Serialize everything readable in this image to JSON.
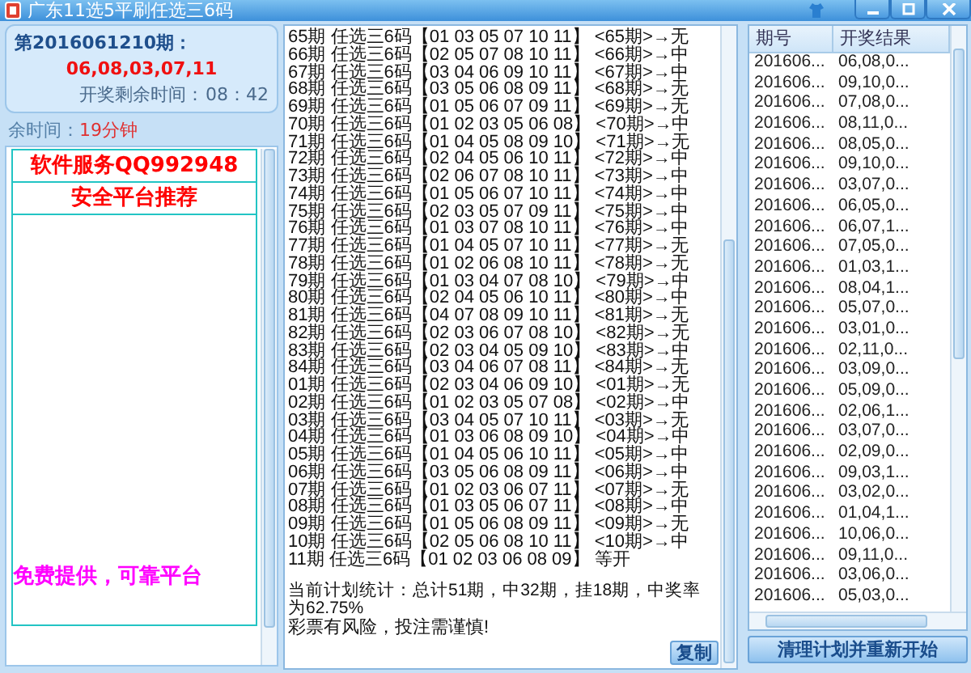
{
  "window": {
    "title": "广东11选5平刷任选三6码"
  },
  "draw_info": {
    "period": "第2016061210期：",
    "numbers": "06,08,03,07,11",
    "countdown_label": "开奖剩余时间：",
    "countdown": "08：42"
  },
  "remaining": {
    "label": "余时间：",
    "value": "19分钟"
  },
  "ads": [
    {
      "text": "软件服务QQ992948",
      "color": "#ff0000"
    },
    {
      "text": "安全平台推荐",
      "color": "#ff0000"
    },
    {
      "text": "免费提供，可靠平台",
      "color": "#ff00ff"
    }
  ],
  "plan": {
    "lines": [
      "65期 任选三6码【01 03 05 07 10 11】 <65期>→无",
      "66期 任选三6码【02 05 07 08 10 11】 <66期>→中",
      "67期 任选三6码【03 04 06 09 10 11】 <67期>→中",
      "68期 任选三6码【03 05 06 08 09 11】 <68期>→无",
      "69期 任选三6码【01 05 06 07 09 11】 <69期>→无",
      "70期 任选三6码【01 02 03 05 06 08】 <70期>→中",
      "71期 任选三6码【01 04 05 08 09 10】 <71期>→无",
      "72期 任选三6码【02 04 05 06 10 11】 <72期>→中",
      "73期 任选三6码【02 06 07 08 10 11】 <73期>→中",
      "74期 任选三6码【01 05 06 07 10 11】 <74期>→中",
      "75期 任选三6码【02 03 05 07 09 11】 <75期>→中",
      "76期 任选三6码【01 03 07 08 10 11】 <76期>→中",
      "77期 任选三6码【01 04 05 07 10 11】 <77期>→无",
      "78期 任选三6码【01 02 06 08 10 11】 <78期>→无",
      "79期 任选三6码【01 03 04 07 08 10】 <79期>→中",
      "80期 任选三6码【02 04 05 06 10 11】 <80期>→中",
      "81期 任选三6码【04 07 08 09 10 11】 <81期>→无",
      "82期 任选三6码【02 03 06 07 08 10】 <82期>→无",
      "83期 任选三6码【02 03 04 05 09 10】 <83期>→中",
      "84期 任选三6码【03 04 06 07 08 11】 <84期>→无",
      "01期 任选三6码【02 03 04 06 09 10】 <01期>→无",
      "02期 任选三6码【01 02 03 05 07 08】 <02期>→中",
      "03期 任选三6码【03 04 05 07 10 11】 <03期>→无",
      "04期 任选三6码【01 03 06 08 09 10】 <04期>→中",
      "05期 任选三6码【01 04 05 06 10 11】 <05期>→中",
      "06期 任选三6码【03 05 06 08 09 11】 <06期>→中",
      "07期 任选三6码【01 02 03 06 07 11】 <07期>→无",
      "08期 任选三6码【01 03 05 06 07 11】 <08期>→中",
      "09期 任选三6码【01 05 06 08 09 11】 <09期>→无",
      "10期 任选三6码【02 05 06 08 10 11】 <10期>→中",
      "11期 任选三6码【01 02 03 06 08 09】 等开"
    ],
    "summary": "当前计划统计：总计51期，中32期，挂18期，中奖率为62.75%",
    "warning": "彩票有风险，投注需谨慎!",
    "copy_button": "复制"
  },
  "history": {
    "columns": [
      "期号",
      "开奖结果"
    ],
    "rows": [
      [
        "201606...",
        "06,08,0..."
      ],
      [
        "201606...",
        "09,10,0..."
      ],
      [
        "201606...",
        "07,08,0..."
      ],
      [
        "201606...",
        "08,11,0..."
      ],
      [
        "201606...",
        "08,05,0..."
      ],
      [
        "201606...",
        "09,10,0..."
      ],
      [
        "201606...",
        "03,07,0..."
      ],
      [
        "201606...",
        "06,05,0..."
      ],
      [
        "201606...",
        "06,07,1..."
      ],
      [
        "201606...",
        "07,05,0..."
      ],
      [
        "201606...",
        "01,03,1..."
      ],
      [
        "201606...",
        "08,04,1..."
      ],
      [
        "201606...",
        "05,07,0..."
      ],
      [
        "201606...",
        "03,01,0..."
      ],
      [
        "201606...",
        "02,11,0..."
      ],
      [
        "201606...",
        "03,09,0..."
      ],
      [
        "201606...",
        "05,09,0..."
      ],
      [
        "201606...",
        "02,06,1..."
      ],
      [
        "201606...",
        "03,07,0..."
      ],
      [
        "201606...",
        "02,09,0..."
      ],
      [
        "201606...",
        "09,03,1..."
      ],
      [
        "201606...",
        "03,02,0..."
      ],
      [
        "201606...",
        "01,04,1..."
      ],
      [
        "201606...",
        "10,06,0..."
      ],
      [
        "201606...",
        "09,11,0..."
      ],
      [
        "201606...",
        "03,06,0..."
      ],
      [
        "201606...",
        "05,03,0..."
      ]
    ],
    "button": "清理计划并重新开始"
  }
}
